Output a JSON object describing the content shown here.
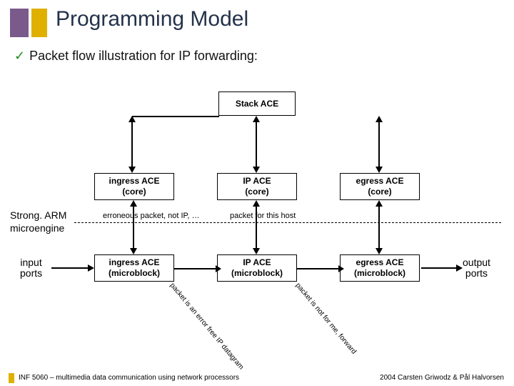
{
  "title": "Programming Model",
  "subtitle": "Packet flow illustration for IP forwarding:",
  "boxes": {
    "stack": "Stack ACE",
    "ingress_core": "ingress ACE\n(core)",
    "ip_core": "IP ACE\n(core)",
    "egress_core": "egress ACE\n(core)",
    "ingress_micro": "ingress ACE\n(microblock)",
    "ip_micro": "IP ACE\n(microblock)",
    "egress_micro": "egress ACE\n(microblock)"
  },
  "notes": {
    "erroneous": "erroneous packet, not IP, …",
    "for_host": "packet for this host"
  },
  "layers": {
    "strongarm": "Strong. ARM",
    "microengine": "microengine"
  },
  "ports": {
    "input": "input\nports",
    "output": "output\nports"
  },
  "diag_labels": {
    "ingress_ip": "packet is an error free IP datagram",
    "ip_egress": "packet is not for me, forward"
  },
  "footer": {
    "left": "INF 5060 – multimedia data communication using network processors",
    "right": "2004  Carsten Griwodz & Pål Halvorsen"
  }
}
